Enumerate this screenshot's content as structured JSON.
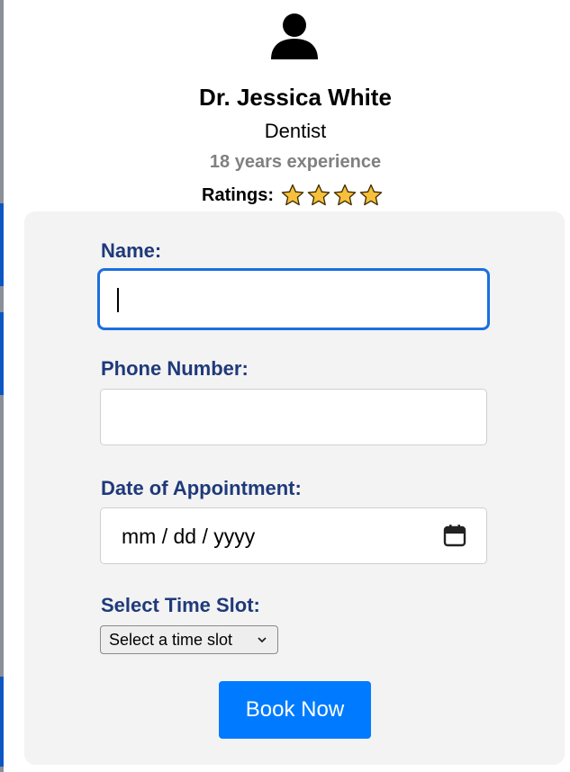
{
  "doctor": {
    "name": "Dr. Jessica White",
    "specialty": "Dentist",
    "experience": "18 years experience",
    "ratings_label": "Ratings:",
    "rating_stars": 4,
    "avatar_icon": "user-icon",
    "star_icon": "star-icon"
  },
  "form": {
    "name_label": "Name:",
    "name_value": "",
    "phone_label": "Phone Number:",
    "phone_value": "",
    "date_label": "Date of Appointment:",
    "date_placeholder": "mm / dd / yyyy",
    "time_label": "Select Time Slot:",
    "time_selected": "Select a time slot",
    "submit_label": "Book Now"
  },
  "colors": {
    "label_color": "#1f3a7a",
    "button_color": "#007bff",
    "focus_color": "#1a6fe0",
    "star_fill": "#f7c03c",
    "card_background": "#f3f3f3"
  }
}
